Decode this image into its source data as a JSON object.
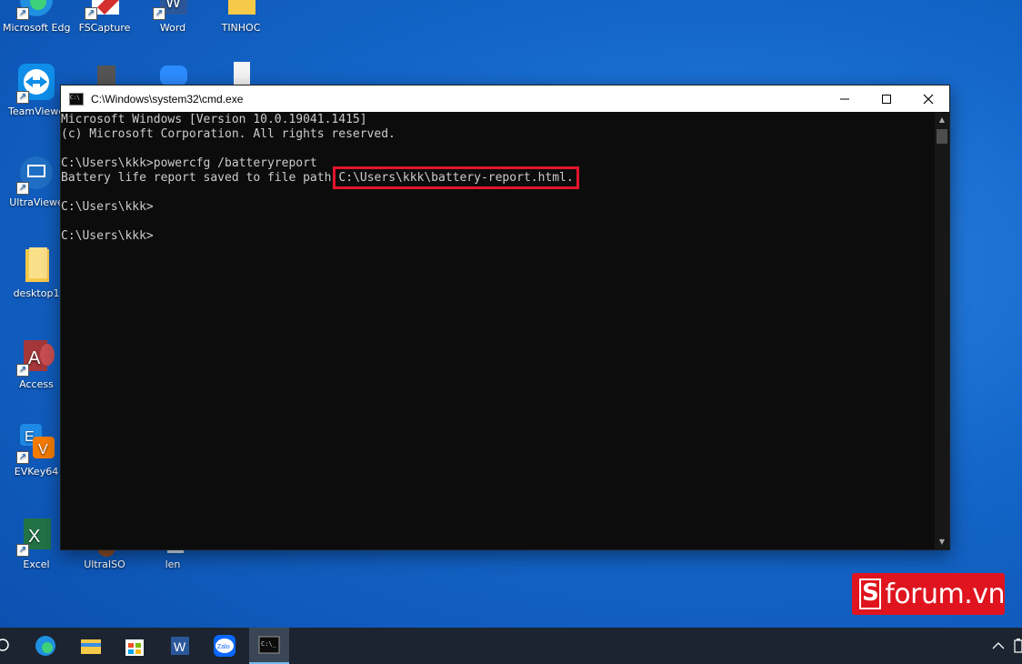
{
  "desktop": {
    "icons": [
      {
        "label": "Microsoft Edge",
        "icon": "edge-icon"
      },
      {
        "label": "FSCapture",
        "icon": "fscapture-icon"
      },
      {
        "label": "Word",
        "icon": "word-icon"
      },
      {
        "label": "TINHOC",
        "icon": "folder-icon"
      },
      {
        "label": "TeamViewe",
        "icon": "teamviewer-icon"
      },
      {
        "label": "UltraViewe",
        "icon": "ultraviewer-icon"
      },
      {
        "label": "desktop1",
        "icon": "folder-icon"
      },
      {
        "label": "Access",
        "icon": "access-icon"
      },
      {
        "label": "EVKey64",
        "icon": "evkey-icon"
      },
      {
        "label": "Excel",
        "icon": "excel-icon"
      },
      {
        "label": "UltraISO",
        "icon": "ultraiso-icon"
      },
      {
        "label": "len",
        "icon": "file-icon"
      }
    ]
  },
  "cmd": {
    "title": "C:\\Windows\\system32\\cmd.exe",
    "lines": [
      "Microsoft Windows [Version 10.0.19041.1415]",
      "(c) Microsoft Corporation. All rights reserved.",
      "",
      "C:\\Users\\kkk>powercfg /batteryreport",
      "Battery life report saved to file path",
      "",
      "C:\\Users\\kkk>",
      "",
      "C:\\Users\\kkk>"
    ],
    "highlighted_path": "C:\\Users\\kkk\\battery-report.html.",
    "highlight_color": "#e2162b"
  },
  "watermark": {
    "text": "forum.vn",
    "letter": "S"
  },
  "taskbar": {
    "items": [
      "search-icon",
      "edge-icon",
      "file-explorer-icon",
      "store-icon",
      "word-icon",
      "zalo-icon",
      "cmd-icon"
    ],
    "zalo_label": "Zalo"
  },
  "colors": {
    "accent": "#e0141e",
    "desktop": "#1466c9",
    "console_text": "#cccccc"
  }
}
